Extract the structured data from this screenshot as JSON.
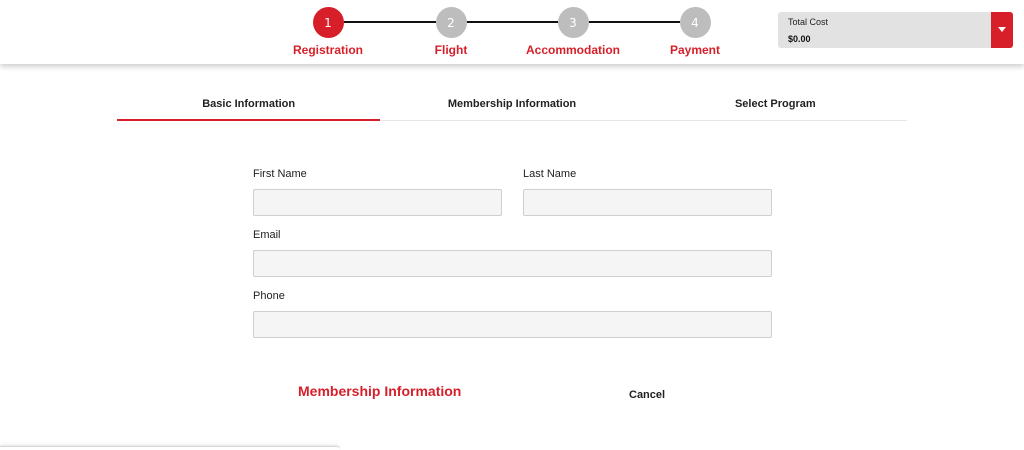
{
  "stepper": {
    "steps": [
      {
        "number": "1",
        "label": "Registration",
        "state": "active"
      },
      {
        "number": "2",
        "label": "Flight",
        "state": "inactive"
      },
      {
        "number": "3",
        "label": "Accommodation",
        "state": "inactive"
      },
      {
        "number": "4",
        "label": "Payment",
        "state": "inactive"
      }
    ]
  },
  "total_cost": {
    "label": "Total Cost",
    "value": "$0.00",
    "toggle_icon": "chevron-down-icon"
  },
  "tabs": [
    {
      "label": "Basic Information",
      "active": true
    },
    {
      "label": "Membership Information",
      "active": false
    },
    {
      "label": "Select Program",
      "active": false
    }
  ],
  "form": {
    "first_name": {
      "label": "First Name",
      "value": "",
      "placeholder": ""
    },
    "last_name": {
      "label": "Last Name",
      "value": "",
      "placeholder": ""
    },
    "email": {
      "label": "Email",
      "value": "",
      "placeholder": ""
    },
    "phone": {
      "label": "Phone",
      "value": "",
      "placeholder": ""
    }
  },
  "actions": {
    "next_label": "Membership Information",
    "cancel_label": "Cancel"
  },
  "colors": {
    "accent": "#d71f2a",
    "step_inactive": "#bdbdbd",
    "input_bg": "#f5f5f5",
    "cost_bg": "#e2e2e2"
  }
}
